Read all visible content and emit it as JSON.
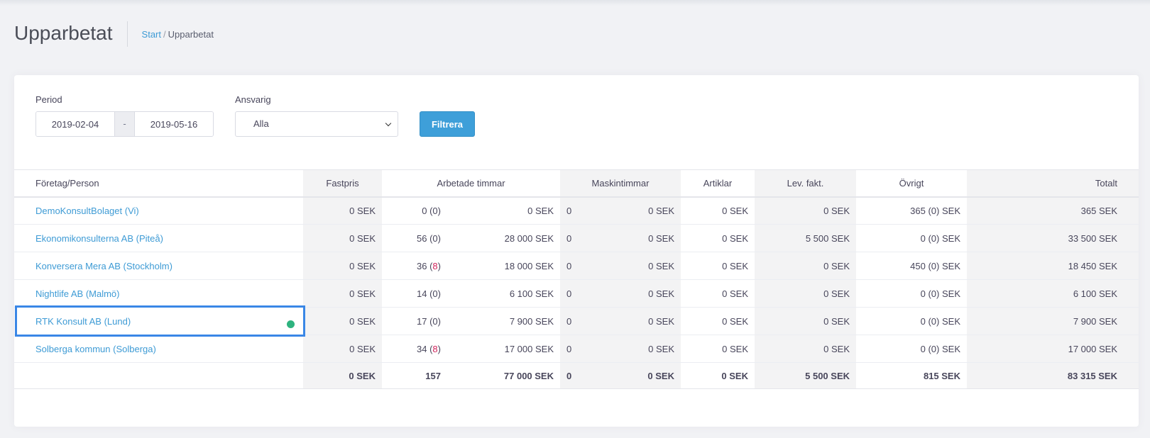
{
  "page": {
    "title": "Upparbetat"
  },
  "breadcrumb": {
    "start": "Start",
    "separator": "/",
    "current": "Upparbetat"
  },
  "filters": {
    "period_label": "Period",
    "date_from": "2019-02-04",
    "date_sep": "-",
    "date_to": "2019-05-16",
    "responsible_label": "Ansvarig",
    "responsible_value": "Alla",
    "filter_button": "Filtrera"
  },
  "table": {
    "headers": {
      "company": "Företag/Person",
      "fixed": "Fastpris",
      "worked": "Arbetade timmar",
      "machine": "Maskintimmar",
      "articles": "Artiklar",
      "supplier": "Lev. fakt.",
      "other": "Övrigt",
      "total": "Totalt"
    },
    "rows": [
      {
        "company": "DemoKonsultBolaget (Vi)",
        "fixed": "0 SEK",
        "hours": "0",
        "hours_extra": "0",
        "hours_extra_red": false,
        "hours_sek": "0 SEK",
        "mach": "0",
        "mach_sek": "0 SEK",
        "articles": "0 SEK",
        "supplier": "0 SEK",
        "other": "365 (0) SEK",
        "total": "365 SEK"
      },
      {
        "company": "Ekonomikonsulterna AB (Piteå)",
        "fixed": "0 SEK",
        "hours": "56",
        "hours_extra": "0",
        "hours_extra_red": false,
        "hours_sek": "28 000 SEK",
        "mach": "0",
        "mach_sek": "0 SEK",
        "articles": "0 SEK",
        "supplier": "5 500 SEK",
        "other": "0 (0) SEK",
        "total": "33 500 SEK"
      },
      {
        "company": "Konversera Mera AB (Stockholm)",
        "fixed": "0 SEK",
        "hours": "36",
        "hours_extra": "8",
        "hours_extra_red": true,
        "hours_sek": "18 000 SEK",
        "mach": "0",
        "mach_sek": "0 SEK",
        "articles": "0 SEK",
        "supplier": "0 SEK",
        "other": "450 (0) SEK",
        "total": "18 450 SEK"
      },
      {
        "company": "Nightlife AB (Malmö)",
        "fixed": "0 SEK",
        "hours": "14",
        "hours_extra": "0",
        "hours_extra_red": false,
        "hours_sek": "6 100 SEK",
        "mach": "0",
        "mach_sek": "0 SEK",
        "articles": "0 SEK",
        "supplier": "0 SEK",
        "other": "0 (0) SEK",
        "total": "6 100 SEK"
      },
      {
        "company": "RTK Konsult AB (Lund)",
        "fixed": "0 SEK",
        "hours": "17",
        "hours_extra": "0",
        "hours_extra_red": false,
        "hours_sek": "7 900 SEK",
        "mach": "0",
        "mach_sek": "0 SEK",
        "articles": "0 SEK",
        "supplier": "0 SEK",
        "other": "0 (0) SEK",
        "total": "7 900 SEK",
        "selected": true,
        "status": "green"
      },
      {
        "company": "Solberga kommun (Solberga)",
        "fixed": "0 SEK",
        "hours": "34",
        "hours_extra": "8",
        "hours_extra_red": true,
        "hours_sek": "17 000 SEK",
        "mach": "0",
        "mach_sek": "0 SEK",
        "articles": "0 SEK",
        "supplier": "0 SEK",
        "other": "0 (0) SEK",
        "total": "17 000 SEK"
      }
    ],
    "totals": {
      "fixed": "0 SEK",
      "hours": "157",
      "hours_sek": "77 000 SEK",
      "mach": "0",
      "mach_sek": "0 SEK",
      "articles": "0 SEK",
      "supplier": "5 500 SEK",
      "other": "815 SEK",
      "total": "83 315 SEK"
    }
  },
  "colors": {
    "accent": "#3e9fd9",
    "link": "#3e9bd5",
    "highlight_red": "#d0245c",
    "selection": "#3a87e6",
    "status_green": "#2eb37f"
  }
}
